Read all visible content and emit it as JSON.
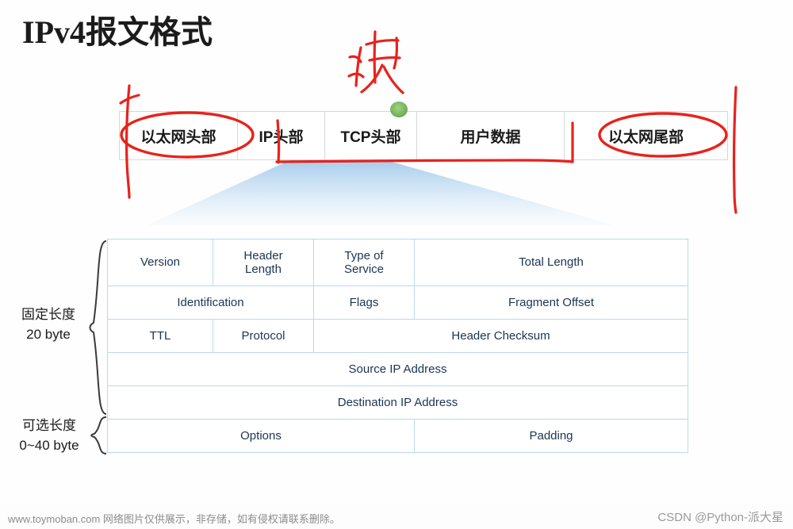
{
  "page": {
    "title": "IPv4报文格式"
  },
  "packet_strip": {
    "cells": [
      {
        "label": "以太网头部",
        "name": "ethernet-header-cell"
      },
      {
        "label": "IP头部",
        "name": "ip-header-cell"
      },
      {
        "label": "TCP头部",
        "name": "tcp-header-cell"
      },
      {
        "label": "用户数据",
        "name": "user-data-cell"
      },
      {
        "label": "以太网尾部",
        "name": "ethernet-trailer-cell"
      }
    ]
  },
  "left_labels": {
    "fixed_line1": "固定长度",
    "fixed_line2": "20 byte",
    "optional_line1": "可选长度",
    "optional_line2": "0~40 byte"
  },
  "ip_header_table": {
    "rows": [
      {
        "cells": [
          {
            "text": "Version"
          },
          {
            "text": "Header\nLength"
          },
          {
            "text": "Type of\nService"
          },
          {
            "text": "Total Length"
          }
        ]
      },
      {
        "cells": [
          {
            "text": "Identification"
          },
          {
            "text": "Flags"
          },
          {
            "text": "Fragment Offset"
          }
        ]
      },
      {
        "cells": [
          {
            "text": "TTL"
          },
          {
            "text": "Protocol"
          },
          {
            "text": "Header Checksum"
          }
        ]
      },
      {
        "cells": [
          {
            "text": "Source IP Address"
          }
        ]
      },
      {
        "cells": [
          {
            "text": "Destination IP Address"
          }
        ]
      },
      {
        "cells": [
          {
            "text": "Options"
          },
          {
            "text": "Padding"
          }
        ]
      }
    ]
  },
  "annotations": {
    "handwritten_mark": "快",
    "ink_color": "#e8221c"
  },
  "footer": {
    "left_text": "www.toymoban.com 网络图片仅供展示，非存储，如有侵权请联系删除。",
    "right_text": "CSDN @Python-派大星"
  }
}
